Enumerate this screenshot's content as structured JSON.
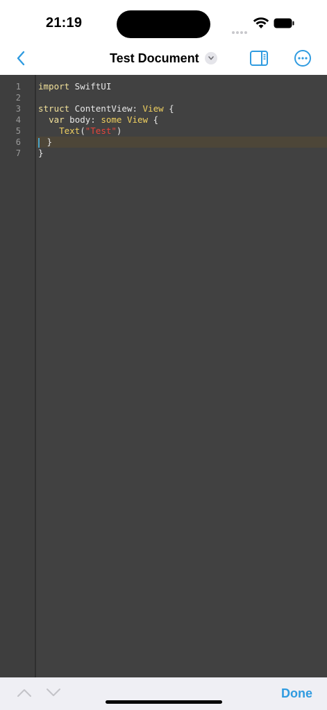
{
  "status_bar": {
    "time": "21:19"
  },
  "nav": {
    "title": "Test Document"
  },
  "editor": {
    "line_numbers": [
      "1",
      "2",
      "3",
      "4",
      "5",
      "6",
      "7"
    ],
    "lines": [
      [
        {
          "text": "import",
          "cls": "kw"
        },
        {
          "text": " SwiftUI",
          "cls": ""
        }
      ],
      [],
      [
        {
          "text": "struct",
          "cls": "kw"
        },
        {
          "text": " ContentView: ",
          "cls": ""
        },
        {
          "text": "View",
          "cls": "ty"
        },
        {
          "text": " {",
          "cls": ""
        }
      ],
      [
        {
          "text": "  ",
          "cls": ""
        },
        {
          "text": "var",
          "cls": "kw"
        },
        {
          "text": " body: ",
          "cls": ""
        },
        {
          "text": "some View",
          "cls": "ty"
        },
        {
          "text": " {",
          "cls": ""
        }
      ],
      [
        {
          "text": "    ",
          "cls": ""
        },
        {
          "text": "Text",
          "cls": "ty"
        },
        {
          "text": "(",
          "cls": ""
        },
        {
          "text": "\"Test\"",
          "cls": "str"
        },
        {
          "text": ")",
          "cls": ""
        }
      ],
      [
        {
          "text": "  }",
          "cls": ""
        }
      ],
      [
        {
          "text": "}",
          "cls": ""
        }
      ]
    ],
    "active_line": 6
  },
  "toolbar": {
    "done_label": "Done"
  },
  "colors": {
    "accent": "#2f9be0",
    "editor_bg": "#414141",
    "keyword": "#f2e19a",
    "string": "#e8443a"
  }
}
